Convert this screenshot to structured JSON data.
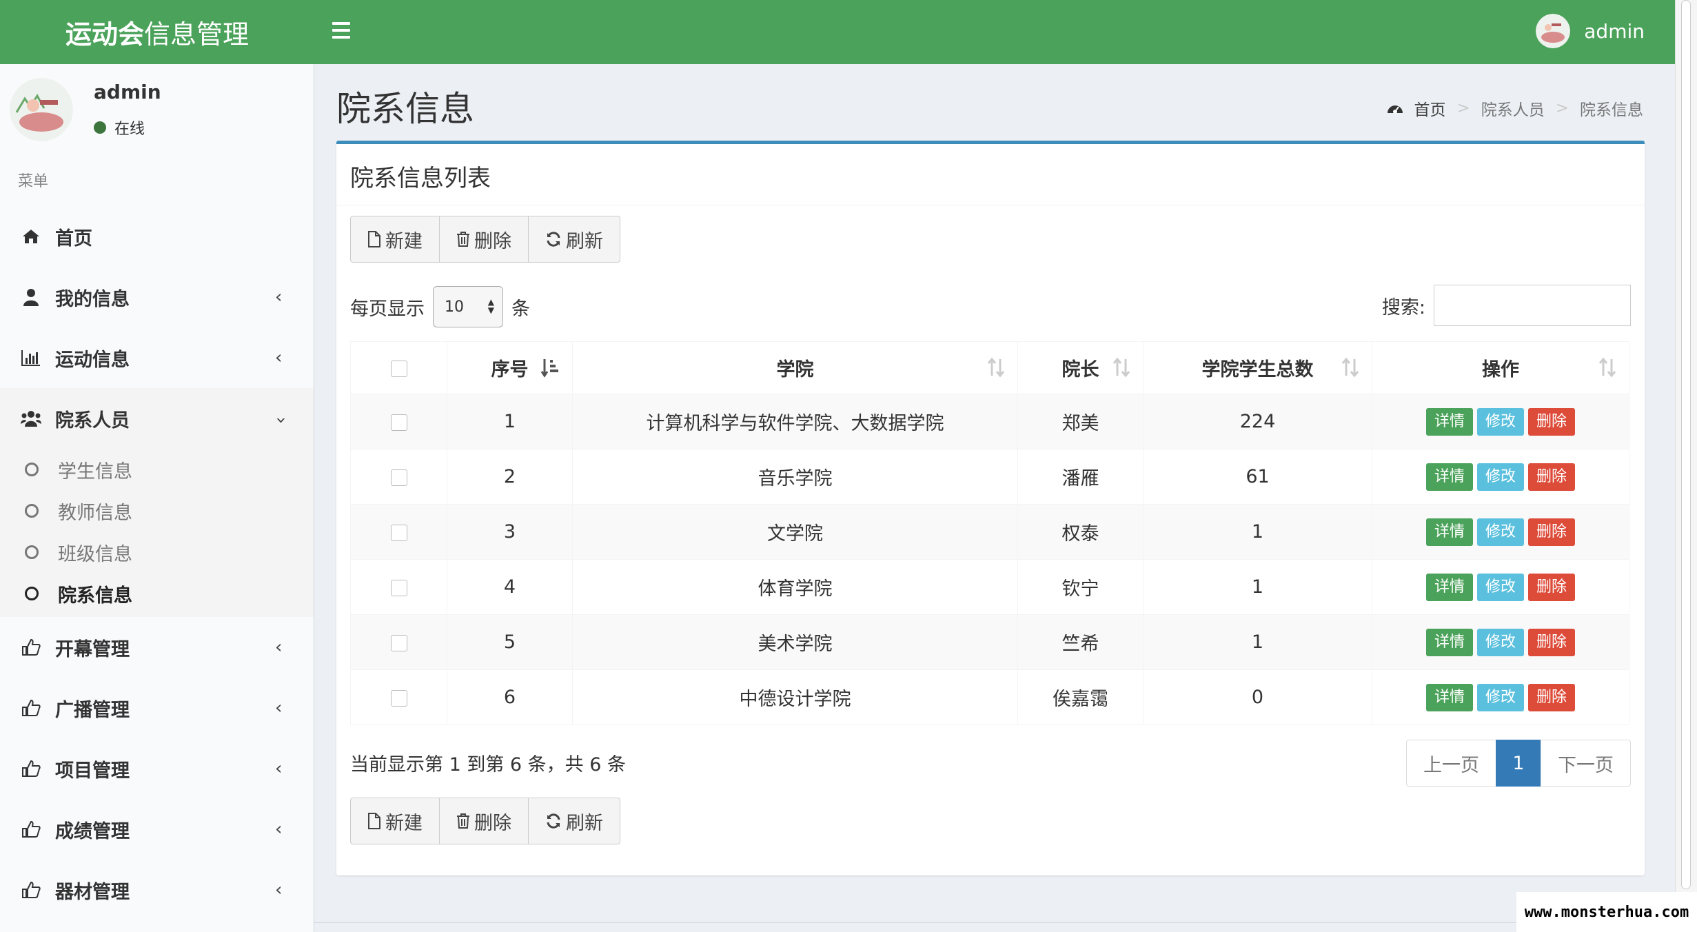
{
  "header": {
    "logo_bold": "运动会",
    "logo_rest": "信息管理",
    "username": "admin"
  },
  "sidebar": {
    "username": "admin",
    "status": "在线",
    "menu_header": "菜单",
    "items": [
      {
        "label": "首页",
        "icon": "home-icon"
      },
      {
        "label": "我的信息",
        "icon": "user-icon"
      },
      {
        "label": "运动信息",
        "icon": "bar-chart-icon"
      },
      {
        "label": "院系人员",
        "icon": "users-icon"
      },
      {
        "label": "开幕管理",
        "icon": "thumbs-up-icon"
      },
      {
        "label": "广播管理",
        "icon": "thumbs-up-icon"
      },
      {
        "label": "项目管理",
        "icon": "thumbs-up-icon"
      },
      {
        "label": "成绩管理",
        "icon": "thumbs-up-icon"
      },
      {
        "label": "器材管理",
        "icon": "thumbs-up-icon"
      }
    ],
    "subitems": [
      {
        "label": "学生信息"
      },
      {
        "label": "教师信息"
      },
      {
        "label": "班级信息"
      },
      {
        "label": "院系信息"
      }
    ]
  },
  "page": {
    "title": "院系信息",
    "breadcrumb": [
      "首页",
      "院系人员",
      "院系信息"
    ]
  },
  "box": {
    "title": "院系信息列表",
    "toolbar": {
      "new": "新建",
      "delete": "删除",
      "refresh": "刷新"
    },
    "length": {
      "prefix": "每页显示",
      "value": "10",
      "suffix": "条"
    },
    "search": {
      "label": "搜索:",
      "value": ""
    },
    "columns": [
      "序号",
      "学院",
      "院长",
      "学院学生总数",
      "操作"
    ],
    "rows": [
      {
        "no": "1",
        "college": "计算机科学与软件学院、大数据学院",
        "dean": "郑美",
        "total": "224"
      },
      {
        "no": "2",
        "college": "音乐学院",
        "dean": "潘雁",
        "total": "61"
      },
      {
        "no": "3",
        "college": "文学院",
        "dean": "权泰",
        "total": "1"
      },
      {
        "no": "4",
        "college": "体育学院",
        "dean": "钦宁",
        "total": "1"
      },
      {
        "no": "5",
        "college": "美术学院",
        "dean": "竺希",
        "total": "1"
      },
      {
        "no": "6",
        "college": "中德设计学院",
        "dean": "俟嘉霭",
        "total": "0"
      }
    ],
    "actions": {
      "detail": "详情",
      "edit": "修改",
      "delete": "删除"
    },
    "info": "当前显示第 1 到第 6 条，共 6 条",
    "pager": {
      "prev": "上一页",
      "current": "1",
      "next": "下一页"
    }
  },
  "watermark": "www.monsterhua.com",
  "colors": {
    "header": "#4ba25a",
    "box_border": "#3c8dbc",
    "detail": "#4ba25a",
    "edit": "#5bc0de",
    "delete": "#dd4b39",
    "page_active": "#337ab7"
  }
}
